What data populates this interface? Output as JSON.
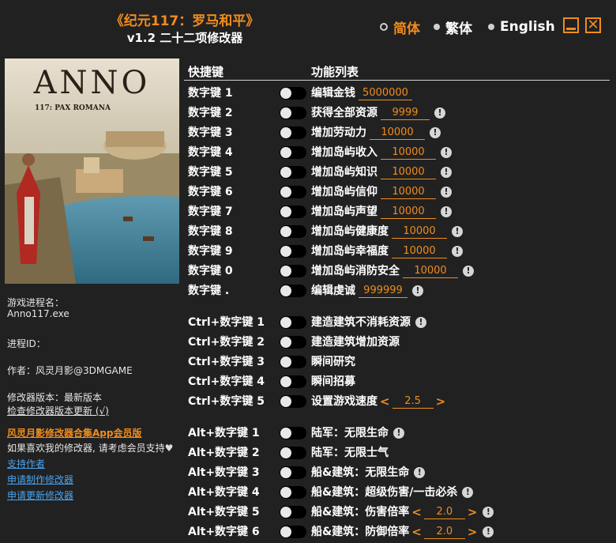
{
  "header": {
    "title": "《纪元117：罗马和平》",
    "subtitle": "v1.2 二十二项修改器"
  },
  "languages": [
    {
      "label": "简体",
      "selected": true
    },
    {
      "label": "繁体",
      "selected": false
    },
    {
      "label": "English",
      "selected": false
    }
  ],
  "cover": {
    "logo": "ANNO",
    "tagline": "117: PAX ROMANA"
  },
  "info": {
    "process_label": "游戏进程名：",
    "process_value": "Anno117.exe",
    "pid_label": "进程ID：",
    "author": "作者：风灵月影@3DMGAME",
    "version": "修改器版本：最新版本",
    "check_update": "检查修改器版本更新 (√)",
    "app_link": "风灵月影修改器合集App会员版",
    "support_text": "如果喜欢我的修改器, 请考虑会员支持",
    "support_author": "支持作者",
    "request_make": "申请制作修改器",
    "request_update": "申请更新修改器"
  },
  "table": {
    "col_key": "快捷键",
    "col_func": "功能列表",
    "rows": [
      {
        "key": "数字键 1",
        "func": "编辑金钱",
        "value": "5000000",
        "warn": false
      },
      {
        "key": "数字键 2",
        "func": "获得全部资源",
        "value": "9999",
        "warn": true
      },
      {
        "key": "数字键 3",
        "func": "增加劳动力",
        "value": "10000",
        "warn": true
      },
      {
        "key": "数字键 4",
        "func": "增加岛屿收入",
        "value": "10000",
        "warn": true
      },
      {
        "key": "数字键 5",
        "func": "增加岛屿知识",
        "value": "10000",
        "warn": true
      },
      {
        "key": "数字键 6",
        "func": "增加岛屿信仰",
        "value": "10000",
        "warn": true
      },
      {
        "key": "数字键 7",
        "func": "增加岛屿声望",
        "value": "10000",
        "warn": true
      },
      {
        "key": "数字键 8",
        "func": "增加岛屿健康度",
        "value": "10000",
        "warn": true
      },
      {
        "key": "数字键 9",
        "func": "增加岛屿幸福度",
        "value": "10000",
        "warn": true
      },
      {
        "key": "数字键 0",
        "func": "增加岛屿消防安全",
        "value": "10000",
        "warn": true
      },
      {
        "key": "数字键 .",
        "func": "编辑虔诚",
        "value": "999999",
        "warn": true
      },
      {
        "key": "Ctrl+数字键 1",
        "func": "建造建筑不消耗资源",
        "warn": true
      },
      {
        "key": "Ctrl+数字键 2",
        "func": "建造建筑增加资源",
        "warn": false
      },
      {
        "key": "Ctrl+数字键 3",
        "func": "瞬间研究",
        "warn": false
      },
      {
        "key": "Ctrl+数字键 4",
        "func": "瞬间招募",
        "warn": false
      },
      {
        "key": "Ctrl+数字键 5",
        "func": "设置游戏速度",
        "value": "2.5",
        "stepper": true,
        "warn": false
      },
      {
        "key": "Alt+数字键 1",
        "func": "陆军：无限生命",
        "warn": true
      },
      {
        "key": "Alt+数字键 2",
        "func": "陆军：无限士气",
        "warn": false
      },
      {
        "key": "Alt+数字键 3",
        "func": "船&建筑：无限生命",
        "warn": true
      },
      {
        "key": "Alt+数字键 4",
        "func": "船&建筑：超级伤害/一击必杀",
        "warn": true
      },
      {
        "key": "Alt+数字键 5",
        "func": "船&建筑：伤害倍率",
        "value": "2.0",
        "stepper": true,
        "warn": true
      },
      {
        "key": "Alt+数字键 6",
        "func": "船&建筑：防御倍率",
        "value": "2.0",
        "stepper": true,
        "warn": true
      }
    ]
  }
}
